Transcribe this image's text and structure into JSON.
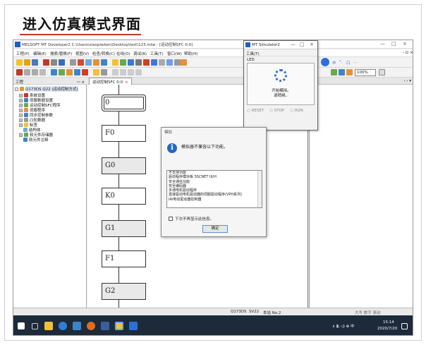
{
  "slide": {
    "title": "进入仿真模式界面"
  },
  "window": {
    "title": "MELSOFT MT Developer2 C:\\Users\\xiaopiwken\\Desktop\\test\\123.mtw - [运动控制SFC 0:0]",
    "controls": {
      "min": "—",
      "max": "□",
      "close": "×",
      "inner_ctl": "- ⊡ ×"
    }
  },
  "menu": [
    "工程(P)",
    "编辑(E)",
    "搜索/替换(F)",
    "视图(V)",
    "检查/转换(C)",
    "在线(O)",
    "调试(B)",
    "工具(T)",
    "窗口(W)",
    "帮助(H)"
  ],
  "toolbar": {
    "zoom": "100%"
  },
  "baidu_bar": {
    "items": [
      "中",
      "°,",
      "口",
      "…"
    ]
  },
  "project": {
    "header": "工程",
    "pin": "ꟷ × ",
    "root": "Q173DS Q22 (运动控制方式)",
    "items": [
      "系统设置",
      "伺服数据设置",
      "运动控制SFC程序",
      "伺服程序",
      "同步控制参数",
      "凸轮数据",
      "标签",
      "结构体",
      "软元件存储器",
      "软元件注释"
    ]
  },
  "editor": {
    "tab_label": "运动控制SFC 0:0",
    "tab_close": "×",
    "right_nav": "‹ › ▾",
    "blocks": [
      "0",
      "F0",
      "G0",
      "K0",
      "G1",
      "F1",
      "G2"
    ]
  },
  "status": {
    "cpu": "Q173DS",
    "sv": "SV22",
    "host": "本站 No.2",
    "ime": "大写 数字 滚动"
  },
  "taskbar": {
    "tray": "∧ 🗈 ◁) ⊕ 中",
    "time": "15:14",
    "date": "2020/7/20"
  },
  "simulator": {
    "title": "MT Simulator2",
    "controls": {
      "min": "—",
      "max": "□",
      "close": "×"
    },
    "menu": "工具(T)",
    "led": "LED",
    "msg1": "开始模拟。",
    "msg2": "请稍候。",
    "radios": [
      "RESET",
      "STOP",
      "RUN"
    ]
  },
  "dialog": {
    "title": "模拟",
    "icon": "i",
    "message": "模拟器不兼容以下功能。",
    "list": [
      "不支持功能",
      "驱动程序模块板 SSCNET III/H",
      "安全通信功能",
      "安全编码器",
      "多通电机驱动程序",
      "直接驱动电机驱动器的伺服驱动程序(VPH系列)",
      "IAI电动驱动器控制器"
    ],
    "checkbox": "下次不再显示此信息。",
    "ok": "确定"
  }
}
